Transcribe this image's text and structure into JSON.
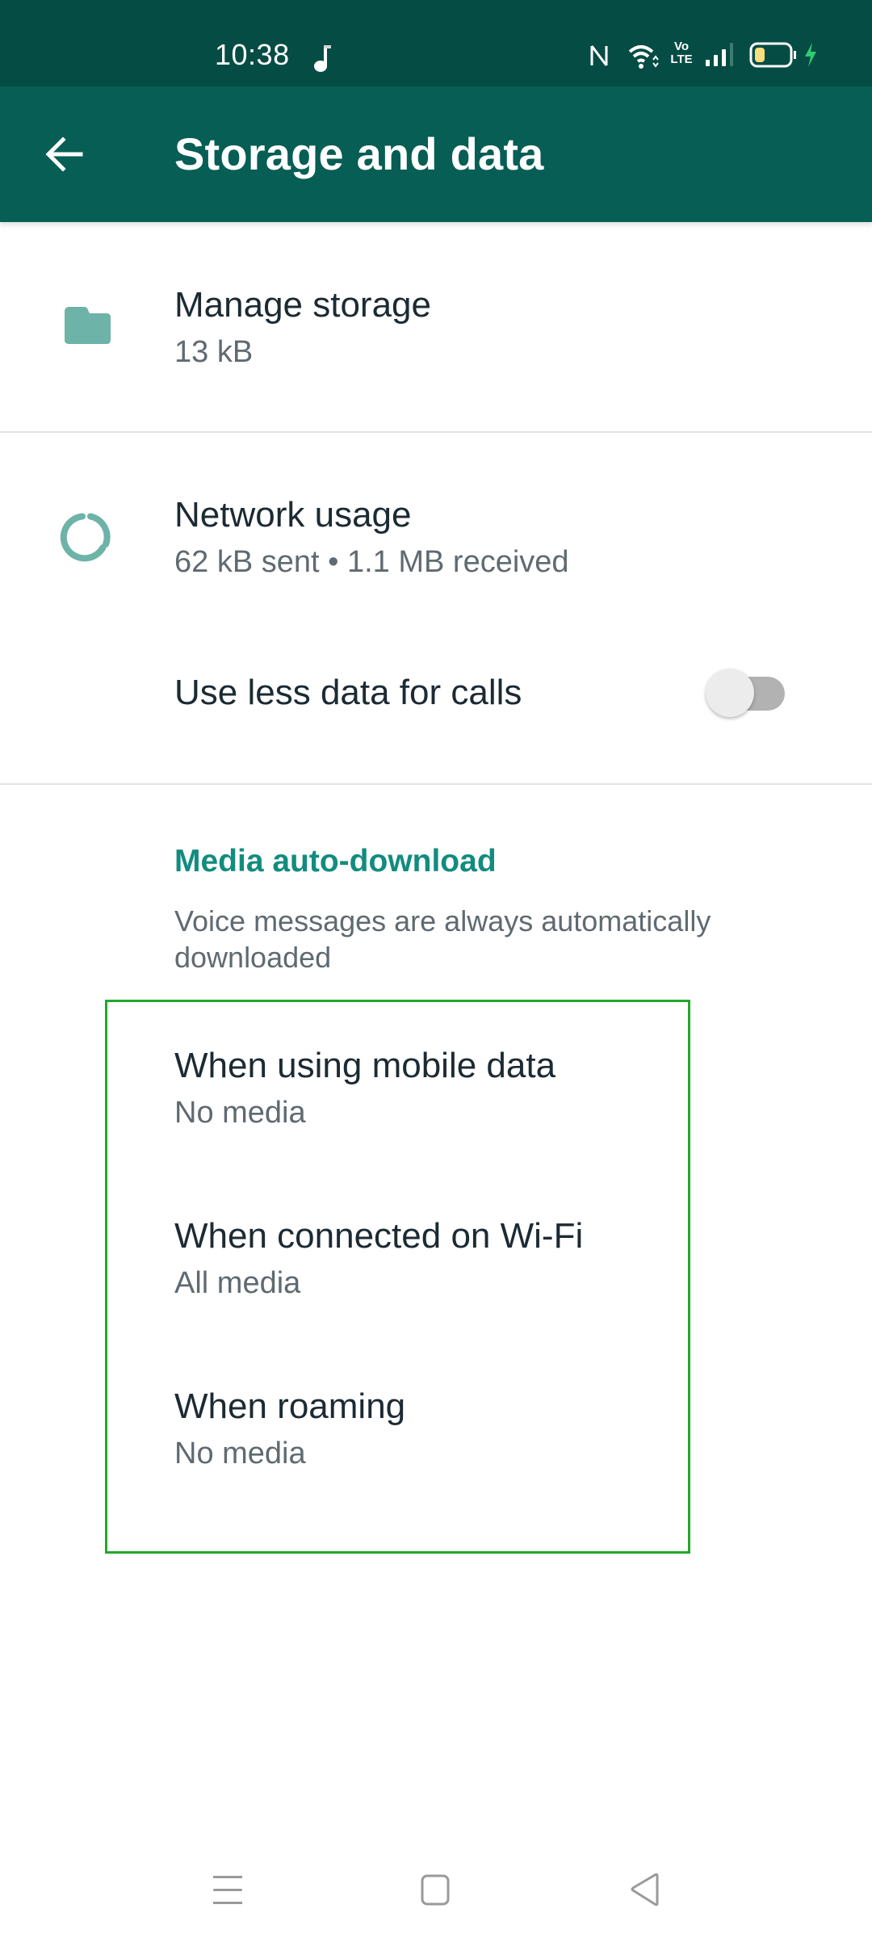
{
  "status_bar": {
    "time": "10:38",
    "battery_level_percent": 30,
    "charging": true,
    "icons": [
      "music-note-icon",
      "nfc-icon",
      "wifi-icon",
      "volte-icon",
      "signal-icon",
      "battery-icon",
      "charging-bolt-icon"
    ],
    "volte_top": "Vo",
    "volte_bottom": "LTE"
  },
  "app_bar": {
    "title": "Storage and data",
    "back_icon": "arrow-left-icon",
    "background_color": "#075e54",
    "status_color": "#054c44"
  },
  "items": {
    "manage_storage": {
      "title": "Manage storage",
      "subtitle": "13 kB",
      "icon": "folder-icon"
    },
    "network_usage": {
      "title": "Network usage",
      "subtitle": "62 kB sent • 1.1 MB received",
      "icon": "data-usage-icon"
    },
    "less_data_calls": {
      "title": "Use less data for calls",
      "toggle_on": false
    }
  },
  "media_auto_download": {
    "header": "Media auto-download",
    "description": "Voice messages are always automatically downloaded",
    "options": [
      {
        "title": "When using mobile data",
        "value": "No media"
      },
      {
        "title": "When connected on Wi-Fi",
        "value": "All media"
      },
      {
        "title": "When roaming",
        "value": "No media"
      }
    ],
    "accent_color": "#128c7e",
    "highlight_color": "#22a82a"
  },
  "nav_bar": {
    "buttons": [
      "menu-icon",
      "home-icon",
      "back-triangle-icon"
    ]
  }
}
